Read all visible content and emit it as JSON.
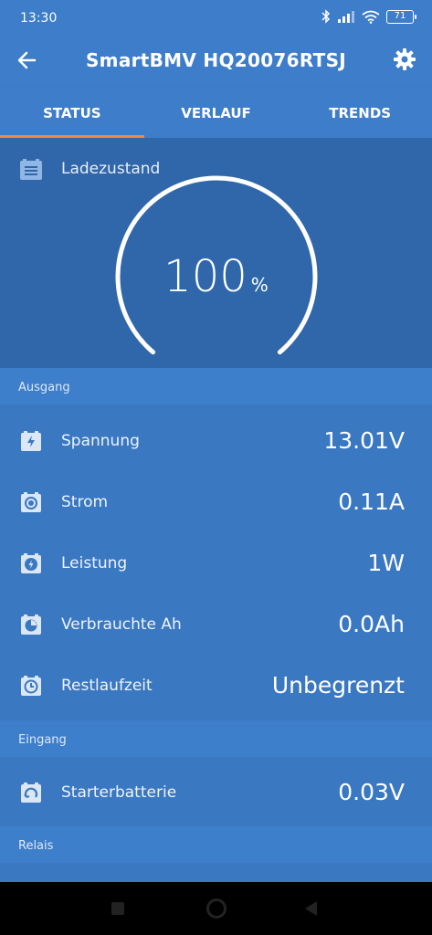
{
  "status_bar": {
    "time": "13:30",
    "battery": "71"
  },
  "app_bar": {
    "title": "SmartBMV HQ20076RTSJ"
  },
  "tabs": [
    {
      "label": "STATUS",
      "active": true
    },
    {
      "label": "VERLAUF",
      "active": false
    },
    {
      "label": "TRENDS",
      "active": false
    }
  ],
  "state_of_charge": {
    "label": "Ladezustand",
    "value": "100",
    "unit": "%",
    "fill_fraction": 1.0
  },
  "sections": {
    "output": {
      "title": "Ausgang",
      "rows": [
        {
          "icon": "lightning-icon",
          "label": "Spannung",
          "value": "13.01V"
        },
        {
          "icon": "current-icon",
          "label": "Strom",
          "value": "0.11A"
        },
        {
          "icon": "power-icon",
          "label": "Leistung",
          "value": "1W"
        },
        {
          "icon": "consumed-icon",
          "label": "Verbrauchte Ah",
          "value": "0.0Ah"
        },
        {
          "icon": "clock-icon",
          "label": "Restlaufzeit",
          "value": "Unbegrenzt"
        }
      ]
    },
    "input": {
      "title": "Eingang",
      "rows": [
        {
          "icon": "starter-battery-icon",
          "label": "Starterbatterie",
          "value": "0.03V"
        }
      ]
    },
    "relay": {
      "title": "Relais"
    }
  },
  "colors": {
    "primary": "#3d7dc9",
    "gauge_background": "#2f67aa",
    "row_background": "#3a78c2",
    "tab_indicator": "#f28a3c"
  }
}
